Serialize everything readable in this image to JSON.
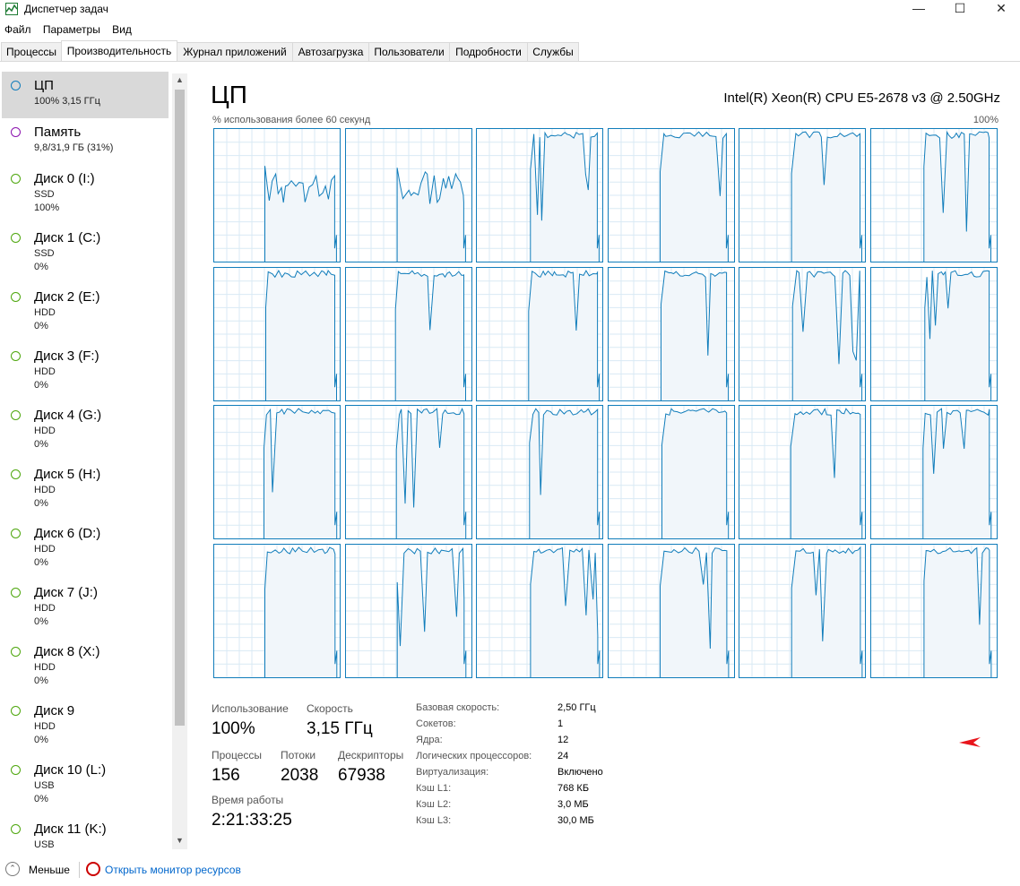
{
  "window": {
    "title": "Диспетчер задач",
    "minimize": "—",
    "maximize": "☐",
    "close": "✕"
  },
  "menu": [
    "Файл",
    "Параметры",
    "Вид"
  ],
  "tabs": [
    "Процессы",
    "Производительность",
    "Журнал приложений",
    "Автозагрузка",
    "Пользователи",
    "Подробности",
    "Службы"
  ],
  "active_tab": "Производительность",
  "sidebar": [
    {
      "name": "ЦП",
      "lines": [
        "100% 3,15 ГГц"
      ],
      "color": "#117dbb",
      "selected": true
    },
    {
      "name": "Память",
      "lines": [
        "9,8/31,9 ГБ (31%)"
      ],
      "color": "#8b12ae"
    },
    {
      "name": "Диск 0 (I:)",
      "lines": [
        "SSD",
        "100%"
      ],
      "color": "#4da60c"
    },
    {
      "name": "Диск 1 (C:)",
      "lines": [
        "SSD",
        "0%"
      ],
      "color": "#4da60c"
    },
    {
      "name": "Диск 2 (E:)",
      "lines": [
        "HDD",
        "0%"
      ],
      "color": "#4da60c"
    },
    {
      "name": "Диск 3 (F:)",
      "lines": [
        "HDD",
        "0%"
      ],
      "color": "#4da60c"
    },
    {
      "name": "Диск 4 (G:)",
      "lines": [
        "HDD",
        "0%"
      ],
      "color": "#4da60c"
    },
    {
      "name": "Диск 5 (H:)",
      "lines": [
        "HDD",
        "0%"
      ],
      "color": "#4da60c"
    },
    {
      "name": "Диск 6 (D:)",
      "lines": [
        "HDD",
        "0%"
      ],
      "color": "#4da60c"
    },
    {
      "name": "Диск 7 (J:)",
      "lines": [
        "HDD",
        "0%"
      ],
      "color": "#4da60c"
    },
    {
      "name": "Диск 8 (X:)",
      "lines": [
        "HDD",
        "0%"
      ],
      "color": "#4da60c"
    },
    {
      "name": "Диск 9",
      "lines": [
        "HDD",
        "0%"
      ],
      "color": "#4da60c"
    },
    {
      "name": "Диск 10 (L:)",
      "lines": [
        "USB",
        "0%"
      ],
      "color": "#4da60c"
    },
    {
      "name": "Диск 11 (K:)",
      "lines": [
        "USB"
      ],
      "color": "#4da60c"
    }
  ],
  "cpu": {
    "title": "ЦП",
    "model": "Intel(R) Xeon(R) CPU E5-2678 v3 @ 2.50GHz",
    "graph_label": "% использования более 60 секунд",
    "graph_max": "100%",
    "logical_graphs": 24,
    "graph_color": "#117dbb",
    "graph_fill": "#f1f6fa"
  },
  "stats": {
    "usage_label": "Использование",
    "usage_value": "100%",
    "speed_label": "Скорость",
    "speed_value": "3,15 ГГц",
    "processes_label": "Процессы",
    "processes_value": "156",
    "threads_label": "Потоки",
    "threads_value": "2038",
    "handles_label": "Дескрипторы",
    "handles_value": "67938",
    "uptime_label": "Время работы",
    "uptime_value": "2:21:33:25"
  },
  "info": [
    {
      "label": "Базовая скорость:",
      "value": "2,50 ГГц"
    },
    {
      "label": "Сокетов:",
      "value": "1"
    },
    {
      "label": "Ядра:",
      "value": "12"
    },
    {
      "label": "Логических процессоров:",
      "value": "24"
    },
    {
      "label": "Виртуализация:",
      "value": "Включено"
    },
    {
      "label": "Кэш L1:",
      "value": "768 КБ"
    },
    {
      "label": "Кэш L2:",
      "value": "3,0 МБ"
    },
    {
      "label": "Кэш L3:",
      "value": "30,0 МБ"
    }
  ],
  "bottom": {
    "fewer": "Меньше",
    "resmon": "Открыть монитор ресурсов"
  }
}
